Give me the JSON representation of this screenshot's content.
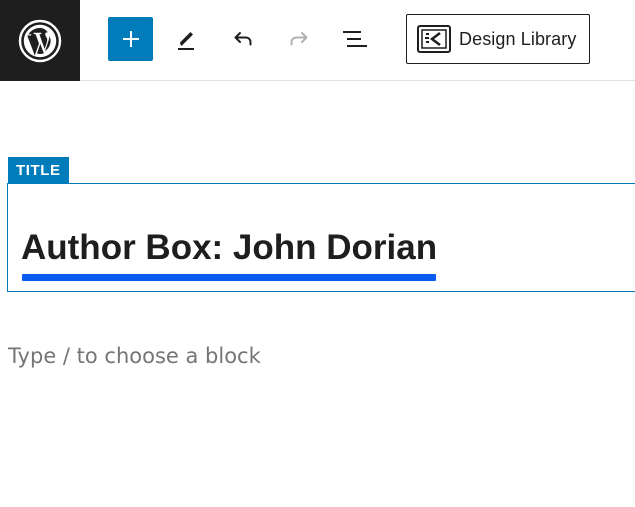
{
  "toolbar": {
    "logo_icon": "wordpress-logo-icon",
    "add_block_icon": "plus-icon",
    "edit_icon": "pencil-icon",
    "undo_icon": "undo-icon",
    "redo_icon": "redo-icon",
    "outline_icon": "list-view-icon",
    "design_library_label": "Design Library",
    "design_library_icon": "design-library-icon",
    "accent_color": "#007cba"
  },
  "title_block": {
    "badge_label": "TITLE",
    "title_text": "Author Box: John Dorian",
    "underline_color": "#0a5bef"
  },
  "editor": {
    "placeholder": "Type / to choose a block"
  }
}
